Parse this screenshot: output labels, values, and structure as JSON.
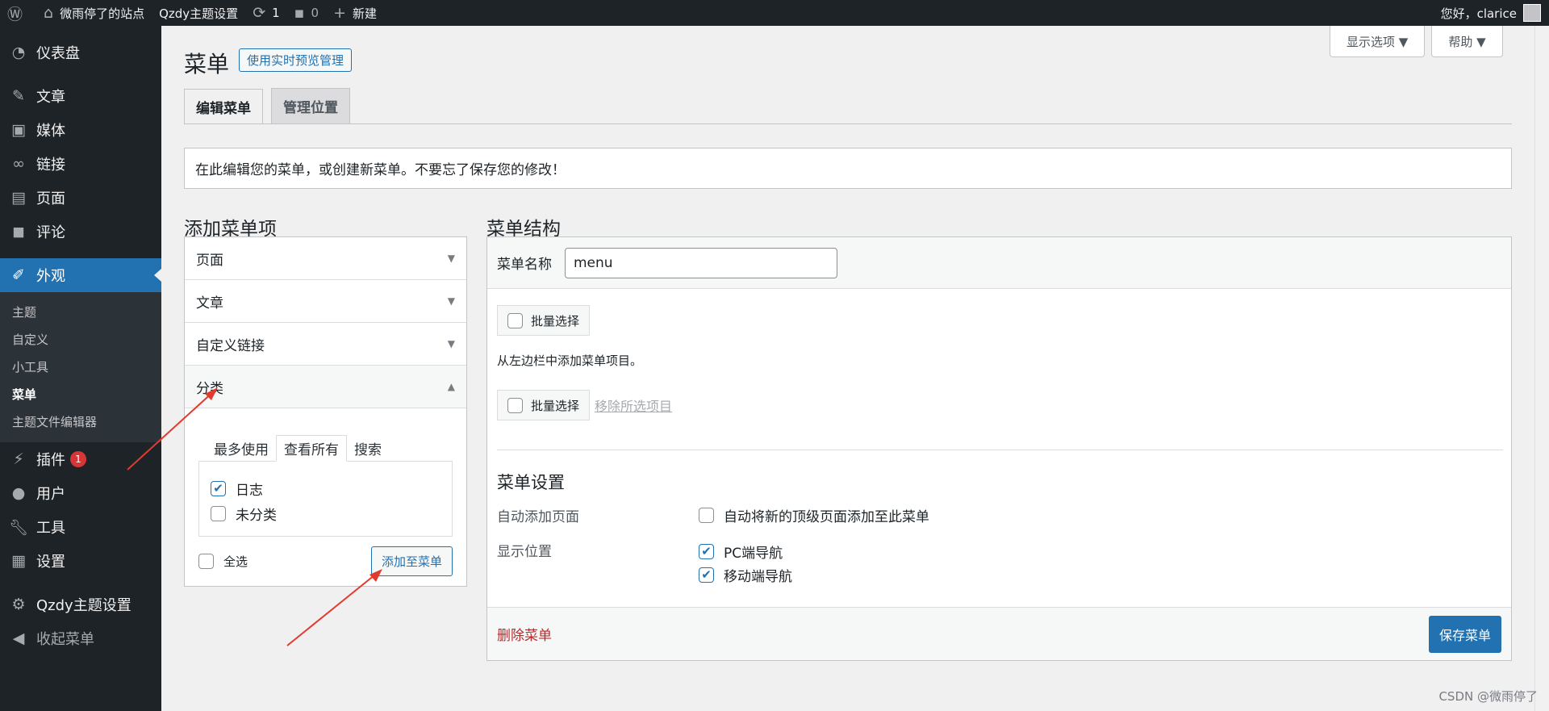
{
  "adminbar": {
    "wp_logo": "wordpress-icon",
    "site_name": "微雨停了的站点",
    "theme_settings": "Qzdy主题设置",
    "updates_count": "1",
    "comments_count": "0",
    "new_label": "新建",
    "greeting": "您好，clarice"
  },
  "sidebar": {
    "items": [
      {
        "label": "仪表盘",
        "icon": "dashboard-icon"
      },
      {
        "label": "文章",
        "icon": "pin-icon"
      },
      {
        "label": "媒体",
        "icon": "media-icon"
      },
      {
        "label": "链接",
        "icon": "link-icon"
      },
      {
        "label": "页面",
        "icon": "page-icon"
      },
      {
        "label": "评论",
        "icon": "comment-icon"
      },
      {
        "label": "外观",
        "icon": "brush-icon"
      },
      {
        "label": "插件",
        "icon": "plugin-icon",
        "badge": "1"
      },
      {
        "label": "用户",
        "icon": "user-icon"
      },
      {
        "label": "工具",
        "icon": "wrench-icon"
      },
      {
        "label": "设置",
        "icon": "settings-icon"
      },
      {
        "label": "Qzdy主题设置",
        "icon": "gear-icon"
      },
      {
        "label": "收起菜单",
        "icon": "collapse-icon"
      }
    ],
    "submenu": [
      "主题",
      "自定义",
      "小工具",
      "菜单",
      "主题文件编辑器"
    ]
  },
  "screen_options": {
    "display": "显示选项 ▼",
    "help": "帮助 ▼"
  },
  "page": {
    "title": "菜单",
    "live_preview": "使用实时预览管理",
    "tabs": [
      "编辑菜单",
      "管理位置"
    ],
    "notice": "在此编辑您的菜单，或创建新菜单。不要忘了保存您的修改！"
  },
  "add_items": {
    "heading": "添加菜单项",
    "sections": [
      "页面",
      "文章",
      "自定义链接",
      "分类"
    ],
    "category_tabs": [
      "最多使用",
      "查看所有",
      "搜索"
    ],
    "categories": [
      {
        "label": "日志",
        "checked": true
      },
      {
        "label": "未分类",
        "checked": false
      }
    ],
    "select_all": "全选",
    "add_button": "添加至菜单"
  },
  "structure": {
    "heading": "菜单结构",
    "name_label": "菜单名称",
    "name_value": "menu",
    "bulk_select": "批量选择",
    "hint": "从左边栏中添加菜单项目。",
    "remove_selected": "移除所选项目",
    "settings_heading": "菜单设置",
    "auto_add_label": "自动添加页面",
    "auto_add_option": "自动将新的顶级页面添加至此菜单",
    "location_label": "显示位置",
    "locations": [
      {
        "label": "PC端导航",
        "checked": true
      },
      {
        "label": "移动端导航",
        "checked": true
      }
    ],
    "delete": "删除菜单",
    "save": "保存菜单"
  },
  "watermark": "CSDN @微雨停了"
}
